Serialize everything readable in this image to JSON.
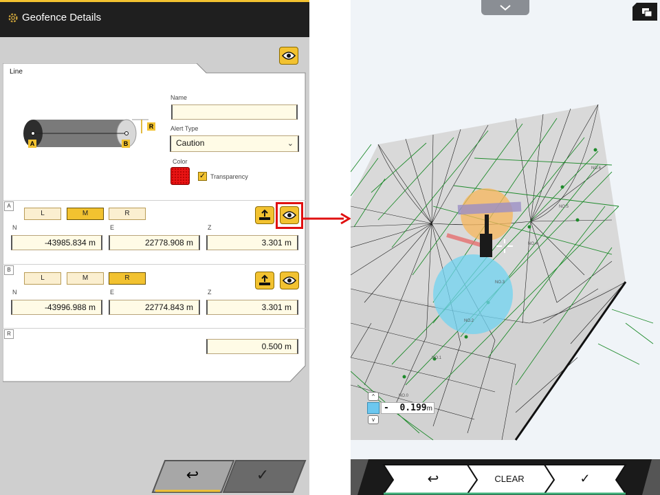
{
  "header": {
    "title": "Geofence Details",
    "icon": "gear-icon"
  },
  "panel": {
    "tab_label": "Line",
    "name": {
      "label": "Name",
      "value": ""
    },
    "alert_type": {
      "label": "Alert Type",
      "value": "Caution"
    },
    "color": {
      "label": "Color",
      "value": "#e81414"
    },
    "transparency": {
      "label": "Transparency",
      "checked": true
    },
    "diagram": {
      "point_a": "A",
      "point_b": "B",
      "radius": "R"
    }
  },
  "section_a": {
    "tag": "A",
    "lmr": [
      "L",
      "M",
      "R"
    ],
    "selected": "M",
    "n": {
      "label": "N",
      "value": "-43985.834 m"
    },
    "e": {
      "label": "E",
      "value": "22778.908 m"
    },
    "z": {
      "label": "Z",
      "value": "3.301 m"
    }
  },
  "section_b": {
    "tag": "B",
    "lmr": [
      "L",
      "M",
      "R"
    ],
    "selected": "R",
    "n": {
      "label": "N",
      "value": "-43996.988 m"
    },
    "e": {
      "label": "E",
      "value": "22774.843 m"
    },
    "z": {
      "label": "Z",
      "value": "3.301 m"
    }
  },
  "section_r": {
    "tag": "R",
    "value": "0.500 m"
  },
  "footer_left": {
    "back": "↩",
    "confirm": "✓"
  },
  "scene": {
    "labels": [
      "NO.6",
      "NO.5",
      "NO.4",
      "NO.3",
      "NO.2",
      "NO.1",
      "NO.0"
    ],
    "elevation": {
      "sign": "-",
      "value": "0.199",
      "unit": "m"
    }
  },
  "footer_right": {
    "back": "↩",
    "clear": "CLEAR",
    "confirm": "✓"
  },
  "colors": {
    "accent": "#f2c230",
    "highlight": "#e01010",
    "fence_blue": "#6fd3f0",
    "fence_orange": "#f7b55a"
  }
}
